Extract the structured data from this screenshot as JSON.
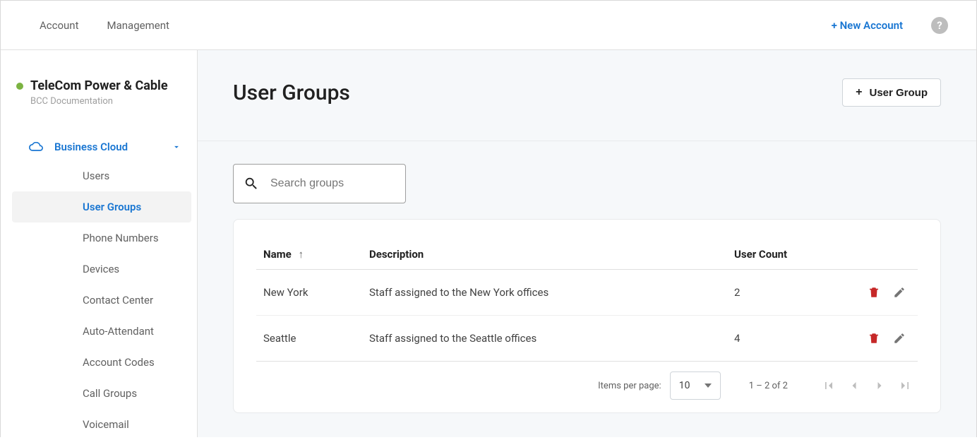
{
  "topnav": {
    "items": [
      {
        "label": "Account"
      },
      {
        "label": "Management"
      }
    ],
    "new_account_label": "+ New Account",
    "help_glyph": "?"
  },
  "account": {
    "name": "TeleCom Power & Cable",
    "sub": "BCC Documentation"
  },
  "sidebar": {
    "parent_label": "Business Cloud",
    "items": [
      {
        "label": "Users",
        "active": false
      },
      {
        "label": "User Groups",
        "active": true
      },
      {
        "label": "Phone Numbers",
        "active": false
      },
      {
        "label": "Devices",
        "active": false
      },
      {
        "label": "Contact Center",
        "active": false
      },
      {
        "label": "Auto-Attendant",
        "active": false
      },
      {
        "label": "Account Codes",
        "active": false
      },
      {
        "label": "Call Groups",
        "active": false
      },
      {
        "label": "Voicemail",
        "active": false
      }
    ]
  },
  "page": {
    "title": "User Groups",
    "add_button_label": "User Group"
  },
  "search": {
    "placeholder": "Search groups"
  },
  "table": {
    "columns": {
      "name": "Name",
      "description": "Description",
      "user_count": "User Count"
    },
    "sort_arrow": "↑",
    "rows": [
      {
        "name": "New York",
        "description": "Staff assigned to the New York offices",
        "user_count": "2"
      },
      {
        "name": "Seattle",
        "description": "Staff assigned to the Seattle offices",
        "user_count": "4"
      }
    ]
  },
  "paginator": {
    "ipp_label": "Items per page:",
    "page_size": "10",
    "range": "1 – 2 of 2"
  },
  "colors": {
    "accent": "#1976d2",
    "danger": "#c62828",
    "muted": "#757575",
    "status": "#7cb342"
  }
}
